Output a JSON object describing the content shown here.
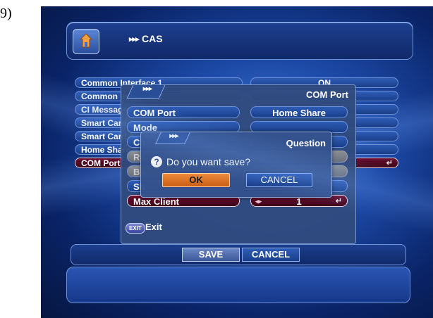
{
  "step_label": "9)",
  "header": {
    "arrows": "▸▸▸",
    "title": "CAS"
  },
  "menu": {
    "items": [
      {
        "label": "Common Interface 1",
        "value": "ON",
        "selected": false
      },
      {
        "label": "Common Interface 2",
        "value": "",
        "selected": false
      },
      {
        "label": "CI Message",
        "value": "",
        "selected": false
      },
      {
        "label": "Smart Card 1",
        "value": "",
        "selected": false
      },
      {
        "label": "Smart Card 2",
        "value": "",
        "selected": false
      },
      {
        "label": "Home Share",
        "value": "",
        "selected": false
      },
      {
        "label": "COM Port",
        "value": "",
        "selected": true
      }
    ]
  },
  "popup": {
    "tab_arrows": "▸▸▸",
    "title": "COM Port",
    "rows": [
      {
        "label": "COM Port",
        "value": "Home Share",
        "state": "normal"
      },
      {
        "label": "Mode",
        "value": "",
        "state": "normal"
      },
      {
        "label": "Ch",
        "value": "",
        "state": "normal"
      },
      {
        "label": "RX",
        "value": "",
        "state": "dim"
      },
      {
        "label": "Ba",
        "value": "",
        "state": "dim"
      },
      {
        "label": "Sh",
        "value": "",
        "state": "normal"
      },
      {
        "label": "Max Client",
        "value": "1",
        "state": "selected"
      }
    ],
    "exit_badge": "EXIT",
    "exit_label": "Exit"
  },
  "dialog": {
    "tab_arrows": "▸▸▸",
    "title": "Question",
    "question": "Do you want save?",
    "ok_label": "OK",
    "cancel_label": "CANCEL"
  },
  "bottom": {
    "save_label": "SAVE",
    "cancel_label": "CANCEL"
  },
  "colors": {
    "accent": "#e07a2e",
    "selected": "#5a0c28",
    "panel": "#1f4699"
  }
}
